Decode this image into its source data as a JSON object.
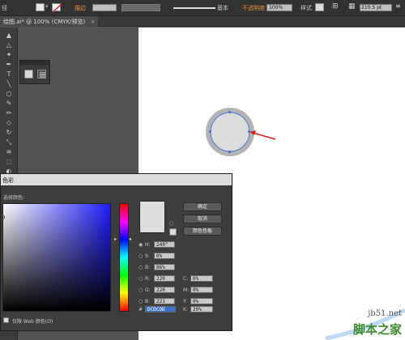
{
  "control_bar": {
    "left_label": "径",
    "stroke_label": "描边",
    "style_label": "基本",
    "opacity_label": "不透明度",
    "opacity_value": "100%",
    "style2_label": "样式",
    "x_value": "210.5 pt"
  },
  "document_tab": {
    "title": "绘图.ai* @ 100% (CMYK/预览)"
  },
  "dialog": {
    "title": "色彩",
    "select_color_label": "选择颜色:",
    "buttons": {
      "ok": "确定",
      "cancel": "取消",
      "swatches": "颜色色板"
    },
    "fields": {
      "H": {
        "label": "H:",
        "value": "240°"
      },
      "S": {
        "label": "S:",
        "value": "0%"
      },
      "B": {
        "label": "B:",
        "value": "86%"
      },
      "R": {
        "label": "R:",
        "value": "220"
      },
      "G": {
        "label": "G:",
        "value": "220"
      },
      "Bl": {
        "label": "B:",
        "value": "221"
      },
      "C": {
        "label": "C:",
        "value": "0%"
      },
      "M": {
        "label": "M:",
        "value": "0%"
      },
      "Y": {
        "label": "Y:",
        "value": "0%"
      },
      "K": {
        "label": "K:",
        "value": "20%"
      },
      "hex": {
        "label": "#",
        "value": "DCDCDD"
      }
    },
    "web_only_label": "仅限 Web 颜色(O)"
  },
  "colors": {
    "selected": "#dcdcdd",
    "circle_stroke": "#b3b3b3",
    "selection_blue": "#4a7bd8",
    "arrow_red": "#e02020"
  },
  "watermark": {
    "line1": "jb51.net",
    "line2": "脚本之家"
  }
}
